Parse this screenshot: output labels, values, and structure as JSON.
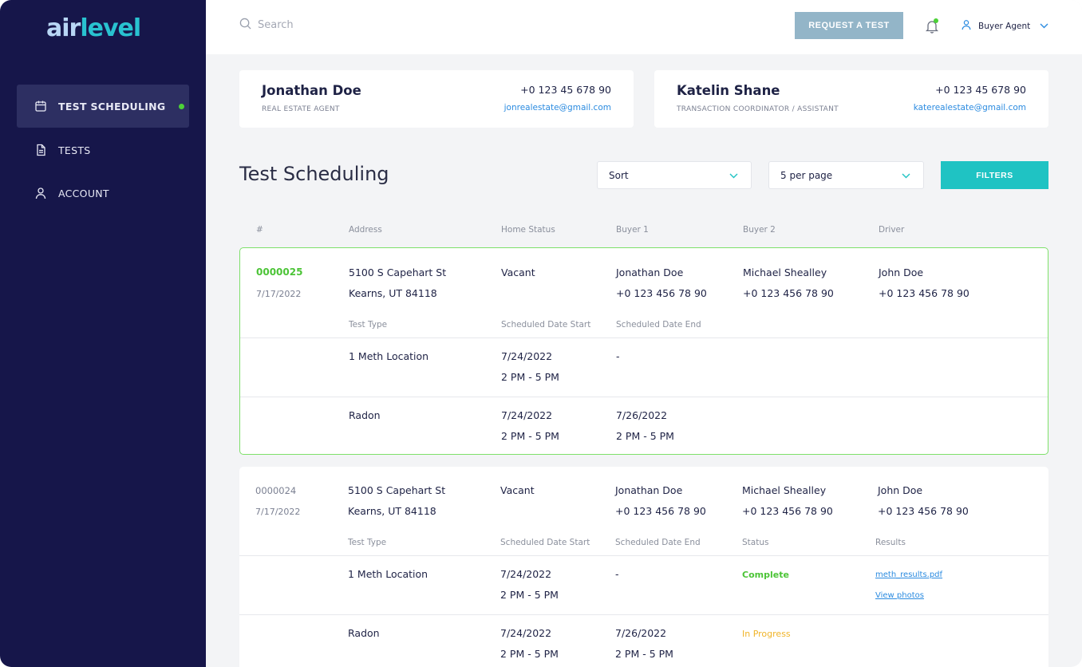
{
  "app": {
    "logo": {
      "part1": "air",
      "part2": "level"
    }
  },
  "sidebar": {
    "items": [
      {
        "label": "TEST SCHEDULING",
        "icon": "calendar-icon"
      },
      {
        "label": "TESTS",
        "icon": "document-icon"
      },
      {
        "label": "ACCOUNT",
        "icon": "user-icon"
      }
    ]
  },
  "topbar": {
    "search_placeholder": "Search",
    "request_button": "REQUEST A TEST",
    "user_role": "Buyer Agent"
  },
  "contacts": [
    {
      "name": "Jonathan Doe",
      "role": "REAL ESTATE AGENT",
      "phone": "+0 123 45 678 90",
      "email": "jonrealestate@gmail.com"
    },
    {
      "name": "Katelin Shane",
      "role": "TRANSACTION COORDINATOR / ASSISTANT",
      "phone": "+0 123 45 678 90",
      "email": "katerealestate@gmail.com"
    }
  ],
  "page": {
    "title": "Test Scheduling",
    "sort_label": "Sort",
    "per_page_label": "5 per page",
    "filters_button": "FILTERS"
  },
  "table": {
    "headers": {
      "num": "#",
      "address": "Address",
      "home_status": "Home Status",
      "buyer1": "Buyer 1",
      "buyer2": "Buyer 2",
      "driver": "Driver"
    },
    "sub_headers": {
      "test_type": "Test Type",
      "date_start": "Scheduled Date Start",
      "date_end": "Scheduled Date End",
      "status": "Status",
      "results": "Results"
    },
    "rows": [
      {
        "id": "0000025",
        "date": "7/17/2022",
        "address_line1": "5100 S Capehart St",
        "address_line2": "Kearns, UT 84118",
        "home_status": "Vacant",
        "buyer1_name": "Jonathan Doe",
        "buyer1_phone": "+0 123 456 78 90",
        "buyer2_name": "Michael Shealley",
        "buyer2_phone": "+0 123 456 78 90",
        "driver_name": "John Doe",
        "driver_phone": "+0 123 456 78 90",
        "tests": [
          {
            "type": "1 Meth Location",
            "start_date": "7/24/2022",
            "start_time": "2 PM - 5 PM",
            "end_date": "-",
            "end_time": ""
          },
          {
            "type": "Radon",
            "start_date": "7/24/2022",
            "start_time": "2 PM - 5 PM",
            "end_date": "7/26/2022",
            "end_time": "2 PM - 5 PM"
          }
        ]
      },
      {
        "id": "0000024",
        "date": "7/17/2022",
        "address_line1": "5100 S Capehart St",
        "address_line2": "Kearns, UT 84118",
        "home_status": "Vacant",
        "buyer1_name": "Jonathan Doe",
        "buyer1_phone": "+0 123 456 78 90",
        "buyer2_name": "Michael Shealley",
        "buyer2_phone": "+0 123 456 78 90",
        "driver_name": "John Doe",
        "driver_phone": "+0 123 456 78 90",
        "tests": [
          {
            "type": "1 Meth Location",
            "start_date": "7/24/2022",
            "start_time": "2 PM - 5 PM",
            "end_date": "-",
            "end_time": "",
            "status": "Complete",
            "result_file": "meth_results.pdf",
            "result_photos": "View photos"
          },
          {
            "type": "Radon",
            "start_date": "7/24/2022",
            "start_time": "2 PM - 5 PM",
            "end_date": "7/26/2022",
            "end_time": "2 PM - 5 PM",
            "status": "In Progress"
          }
        ]
      }
    ]
  },
  "colors": {
    "sidebar_bg": "#16164a",
    "accent_teal": "#1fc3c3",
    "request_btn": "#93b5c8",
    "success": "#4cc437",
    "warning": "#f0b429",
    "link": "#2b8be0"
  }
}
